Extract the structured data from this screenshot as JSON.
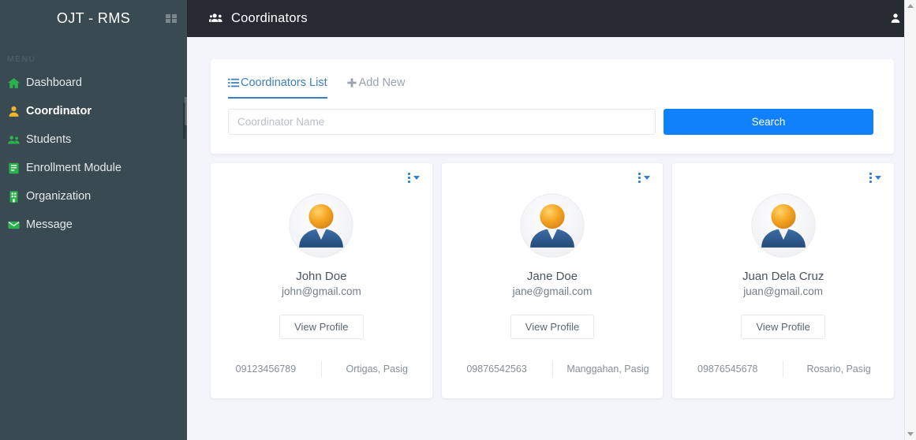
{
  "sidebar": {
    "brand": "OJT - RMS",
    "grid_icon": "grid-icon",
    "menu_label": "MENU",
    "items": [
      {
        "label": "Dashboard",
        "icon": "home-icon",
        "active": false
      },
      {
        "label": "Coordinator",
        "icon": "user-icon",
        "active": true
      },
      {
        "label": "Students",
        "icon": "users-icon",
        "active": false
      },
      {
        "label": "Enrollment Module",
        "icon": "book-icon",
        "active": false
      },
      {
        "label": "Organization",
        "icon": "building-icon",
        "active": false
      },
      {
        "label": "Message",
        "icon": "envelope-icon",
        "active": false
      }
    ]
  },
  "topbar": {
    "title": "Coordinators",
    "title_icon": "users-group-icon",
    "account_icon": "user-account-icon"
  },
  "panel": {
    "tabs": [
      {
        "label": "Coordinators List",
        "icon": "list-icon",
        "active": true
      },
      {
        "label": "Add New",
        "icon": "plus-icon",
        "active": false
      }
    ],
    "search": {
      "placeholder": "Coordinator Name",
      "value": "",
      "button_label": "Search"
    }
  },
  "cards": [
    {
      "name": "John Doe",
      "email": "john@gmail.com",
      "button_label": "View Profile",
      "phone": "09123456789",
      "location": "Ortigas, Pasig",
      "avatar": "avatar-user-icon",
      "menu_icon": "ellipsis-vertical-icon"
    },
    {
      "name": "Jane Doe",
      "email": "jane@gmail.com",
      "button_label": "View Profile",
      "phone": "09876542563",
      "location": "Manggahan, Pasig",
      "avatar": "avatar-user-icon",
      "menu_icon": "ellipsis-vertical-icon"
    },
    {
      "name": "Juan Dela Cruz",
      "email": "juan@gmail.com",
      "button_label": "View Profile",
      "phone": "09876545678",
      "location": "Rosario, Pasig",
      "avatar": "avatar-user-icon",
      "menu_icon": "ellipsis-vertical-icon"
    }
  ],
  "colors": {
    "sidebar_bg": "#3a4a52",
    "topbar_bg": "#252b31",
    "page_bg": "#f4f5fa",
    "accent_blue": "#1180fb",
    "tab_active": "#3b7fc4",
    "icon_green": "#2bb24c",
    "icon_gold": "#f0b429"
  }
}
